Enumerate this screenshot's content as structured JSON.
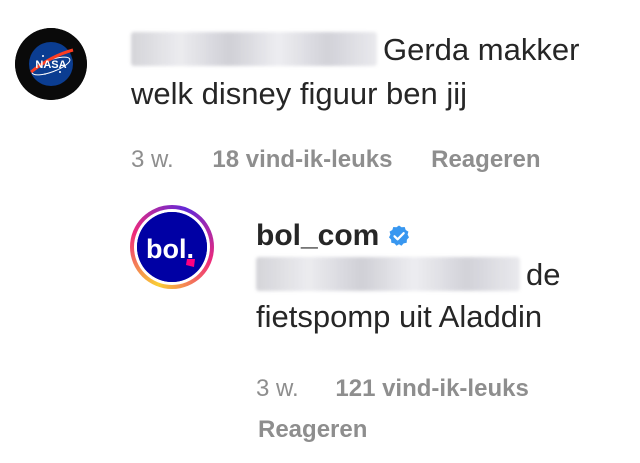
{
  "comment": {
    "avatar_icon": "nasa-logo",
    "text": "Gerda makker welk disney figuur ben jij",
    "time": "3 w.",
    "likes": "18 vind-ik-leuks",
    "reply_label": "Reageren",
    "mention_blurred": true
  },
  "reply": {
    "avatar_icon": "bol-logo",
    "avatar_text": "bol.",
    "username": "bol_com",
    "verified_icon": "verified-badge",
    "text_line1": "de",
    "text_line2": "fietspomp uit Aladdin",
    "time": "3 w.",
    "likes": "121 vind-ik-leuks",
    "reply_label": "Reageren",
    "mention_blurred": true
  },
  "colors": {
    "text": "#262626",
    "meta": "#8e8e8e",
    "verified": "#3897f0",
    "bol_blue": "#0000a4",
    "bol_pink": "#ff0080"
  },
  "badge": {
    "nasa": "NASA"
  }
}
